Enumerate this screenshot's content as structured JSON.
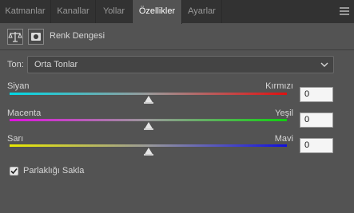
{
  "tabs": [
    {
      "label": "Katmanlar",
      "active": false
    },
    {
      "label": "Kanallar",
      "active": false
    },
    {
      "label": "Yollar",
      "active": false
    },
    {
      "label": "Özellikler",
      "active": true
    },
    {
      "label": "Ayarlar",
      "active": false
    }
  ],
  "header": {
    "title": "Renk Dengesi",
    "icons": [
      "color-balance-icon",
      "layer-mask-icon"
    ]
  },
  "tone": {
    "label": "Ton:",
    "value": "Orta Tonlar"
  },
  "sliders": [
    {
      "left": "Siyan",
      "right": "Kırmızı",
      "value": "0",
      "position": 0.5,
      "colors": [
        "#00d8e6",
        "#e01010"
      ]
    },
    {
      "left": "Macenta",
      "right": "Yeşil",
      "value": "0",
      "position": 0.5,
      "colors": [
        "#e010e0",
        "#10d010"
      ]
    },
    {
      "left": "Sarı",
      "right": "Mavi",
      "value": "0",
      "position": 0.5,
      "colors": [
        "#e8e800",
        "#1010e0"
      ]
    }
  ],
  "preserve_luminosity": {
    "label": "Parlaklığı Sakla",
    "checked": true
  }
}
